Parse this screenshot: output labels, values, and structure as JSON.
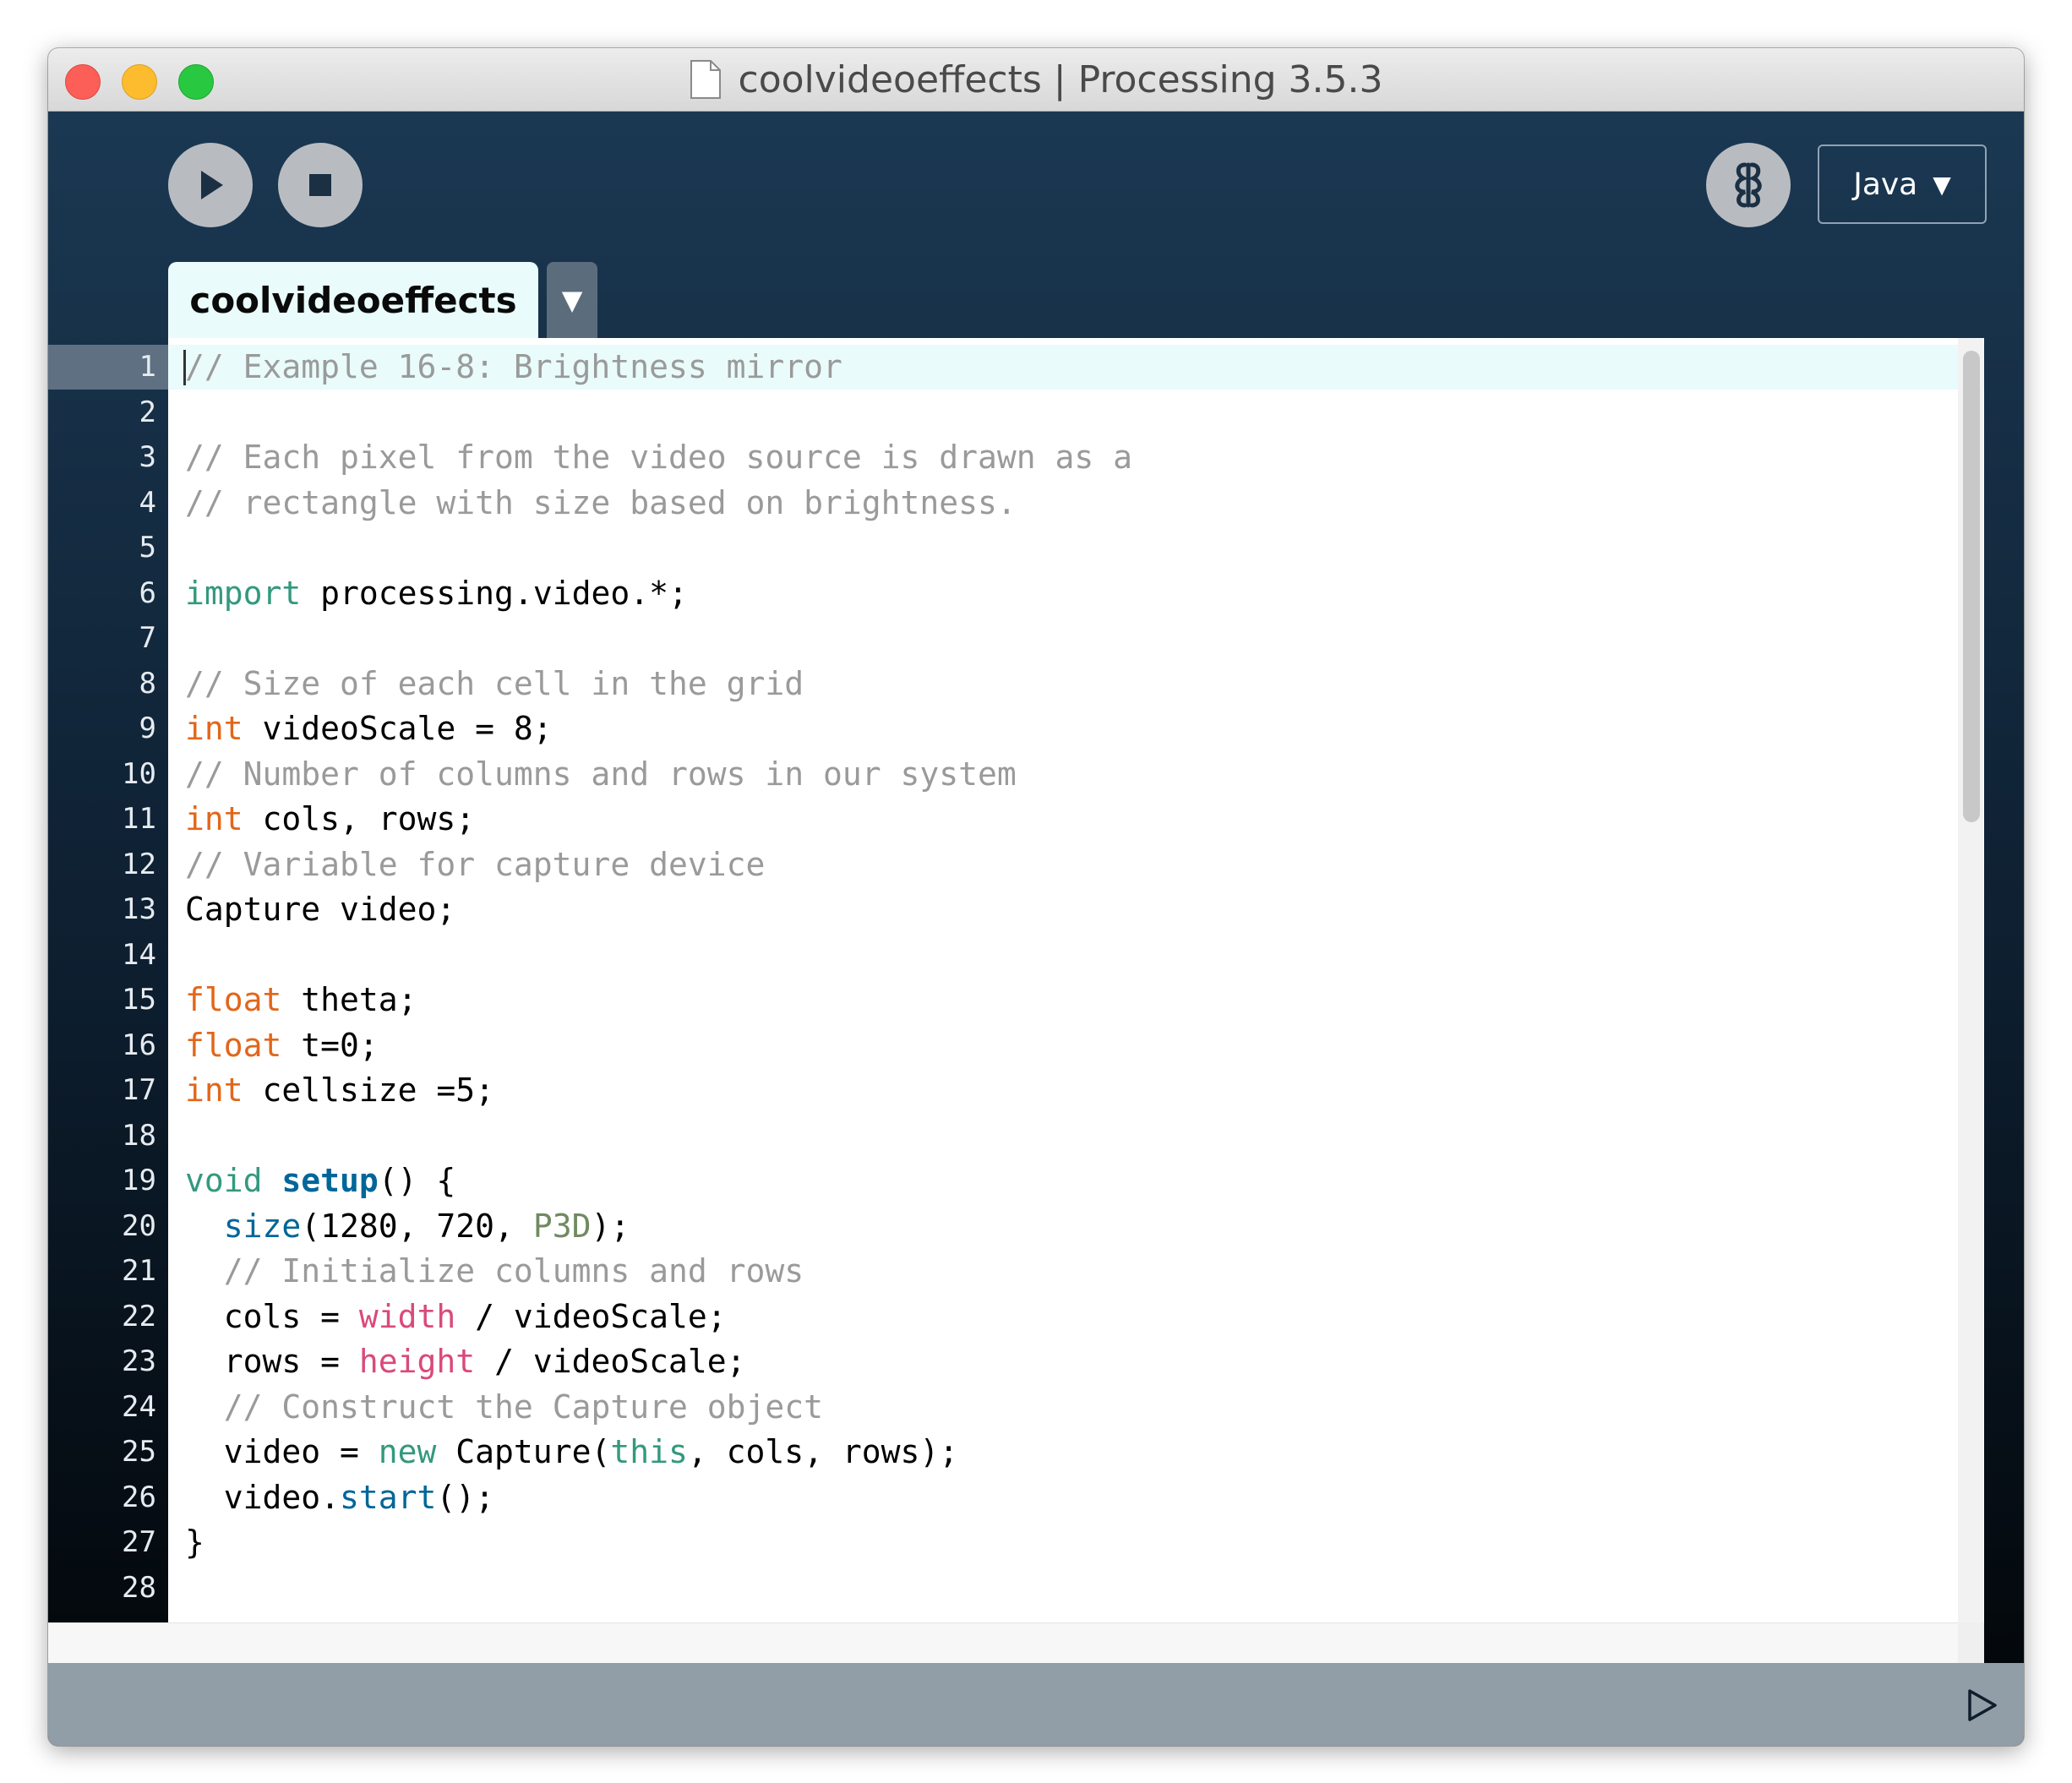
{
  "window": {
    "title": "coolvideoeffects | Processing 3.5.3"
  },
  "toolbar": {
    "run_icon": "play-icon",
    "stop_icon": "stop-icon",
    "debug_icon": "debug-icon",
    "mode": "Java",
    "mode_arrow": "▼"
  },
  "tabs": [
    {
      "label": "coolvideoeffects",
      "active": true
    }
  ],
  "tab_menu_arrow": "▼",
  "editor": {
    "current_line": 1,
    "line_numbers": [
      "1",
      "2",
      "3",
      "4",
      "5",
      "6",
      "7",
      "8",
      "9",
      "10",
      "11",
      "12",
      "13",
      "14",
      "15",
      "16",
      "17",
      "18",
      "19",
      "20",
      "21",
      "22",
      "23",
      "24",
      "25",
      "26",
      "27",
      "28"
    ],
    "lines": [
      [
        {
          "t": "comment",
          "s": "// Example 16-8: Brightness mirror"
        }
      ],
      [],
      [
        {
          "t": "comment",
          "s": "// Each pixel from the video source is drawn as a"
        }
      ],
      [
        {
          "t": "comment",
          "s": "// rectangle with size based on brightness."
        }
      ],
      [],
      [
        {
          "t": "keyword",
          "s": "import"
        },
        {
          "t": "plain",
          "s": " processing.video.*;"
        }
      ],
      [],
      [
        {
          "t": "comment",
          "s": "// Size of each cell in the grid"
        }
      ],
      [
        {
          "t": "type",
          "s": "int"
        },
        {
          "t": "plain",
          "s": " videoScale = 8;"
        }
      ],
      [
        {
          "t": "comment",
          "s": "// Number of columns and rows in our system"
        }
      ],
      [
        {
          "t": "type",
          "s": "int"
        },
        {
          "t": "plain",
          "s": " cols, rows;"
        }
      ],
      [
        {
          "t": "comment",
          "s": "// Variable for capture device"
        }
      ],
      [
        {
          "t": "plain",
          "s": "Capture video;"
        }
      ],
      [],
      [
        {
          "t": "type",
          "s": "float"
        },
        {
          "t": "plain",
          "s": " theta;"
        }
      ],
      [
        {
          "t": "type",
          "s": "float"
        },
        {
          "t": "plain",
          "s": " t=0;"
        }
      ],
      [
        {
          "t": "type",
          "s": "int"
        },
        {
          "t": "plain",
          "s": " cellsize =5;"
        }
      ],
      [],
      [
        {
          "t": "keyword",
          "s": "void"
        },
        {
          "t": "plain",
          "s": " "
        },
        {
          "t": "function-bold",
          "s": "setup"
        },
        {
          "t": "plain",
          "s": "() {"
        }
      ],
      [
        {
          "t": "plain",
          "s": "  "
        },
        {
          "t": "function",
          "s": "size"
        },
        {
          "t": "plain",
          "s": "(1280, 720, "
        },
        {
          "t": "constant",
          "s": "P3D"
        },
        {
          "t": "plain",
          "s": ");"
        }
      ],
      [
        {
          "t": "plain",
          "s": "  "
        },
        {
          "t": "comment",
          "s": "// Initialize columns and rows"
        }
      ],
      [
        {
          "t": "plain",
          "s": "  cols = "
        },
        {
          "t": "builtin",
          "s": "width"
        },
        {
          "t": "plain",
          "s": " / videoScale;"
        }
      ],
      [
        {
          "t": "plain",
          "s": "  rows = "
        },
        {
          "t": "builtin",
          "s": "height"
        },
        {
          "t": "plain",
          "s": " / videoScale;"
        }
      ],
      [
        {
          "t": "plain",
          "s": "  "
        },
        {
          "t": "comment",
          "s": "// Construct the Capture object"
        }
      ],
      [
        {
          "t": "plain",
          "s": "  video = "
        },
        {
          "t": "keyword",
          "s": "new"
        },
        {
          "t": "plain",
          "s": " Capture("
        },
        {
          "t": "keyword",
          "s": "this"
        },
        {
          "t": "plain",
          "s": ", cols, rows);"
        }
      ],
      [
        {
          "t": "plain",
          "s": "  video."
        },
        {
          "t": "function",
          "s": "start"
        },
        {
          "t": "plain",
          "s": "();"
        }
      ],
      [
        {
          "t": "plain",
          "s": "}"
        }
      ],
      []
    ]
  },
  "console_toggle_icon": "console-toggle-icon"
}
